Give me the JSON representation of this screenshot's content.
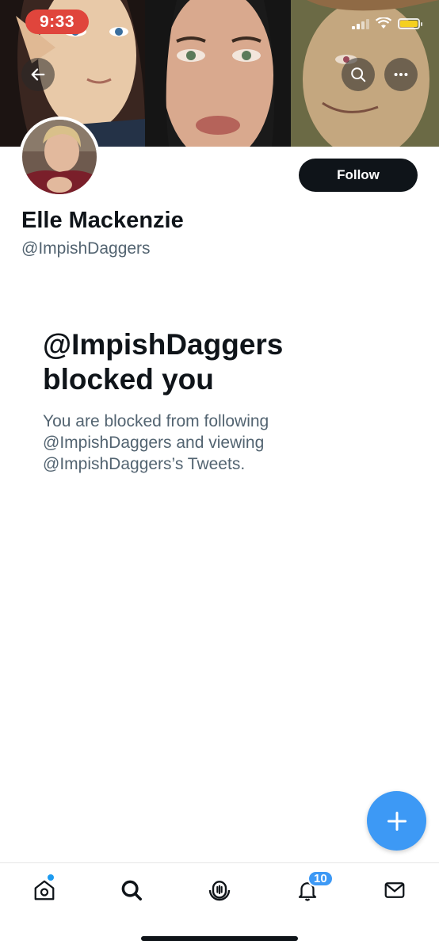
{
  "status_bar": {
    "time": "9:33",
    "battery_color": "#f5d020",
    "time_pill_color": "#e0453c"
  },
  "header": {
    "back_icon": "arrow-left-icon",
    "search_icon": "search-icon",
    "more_icon": "more-horizontal-icon"
  },
  "profile": {
    "display_name": "Elle Mackenzie",
    "handle": "@ImpishDaggers",
    "follow_label": "Follow"
  },
  "blocked": {
    "title": "@ImpishDaggers blocked you",
    "body": "You are blocked from following @ImpishDaggers and viewing @ImpishDaggers’s Tweets."
  },
  "fab": {
    "icon": "plus-icon",
    "color": "#3d99f5"
  },
  "tabbar": {
    "tabs": [
      {
        "name": "home",
        "icon": "home-icon"
      },
      {
        "name": "search",
        "icon": "search-icon"
      },
      {
        "name": "spaces",
        "icon": "spaces-icon"
      },
      {
        "name": "notifications",
        "icon": "bell-icon",
        "badge": "10"
      },
      {
        "name": "messages",
        "icon": "mail-icon"
      }
    ]
  },
  "colors": {
    "primary_text": "#0f1419",
    "secondary_text": "#536471",
    "accent": "#1d9bf0"
  }
}
